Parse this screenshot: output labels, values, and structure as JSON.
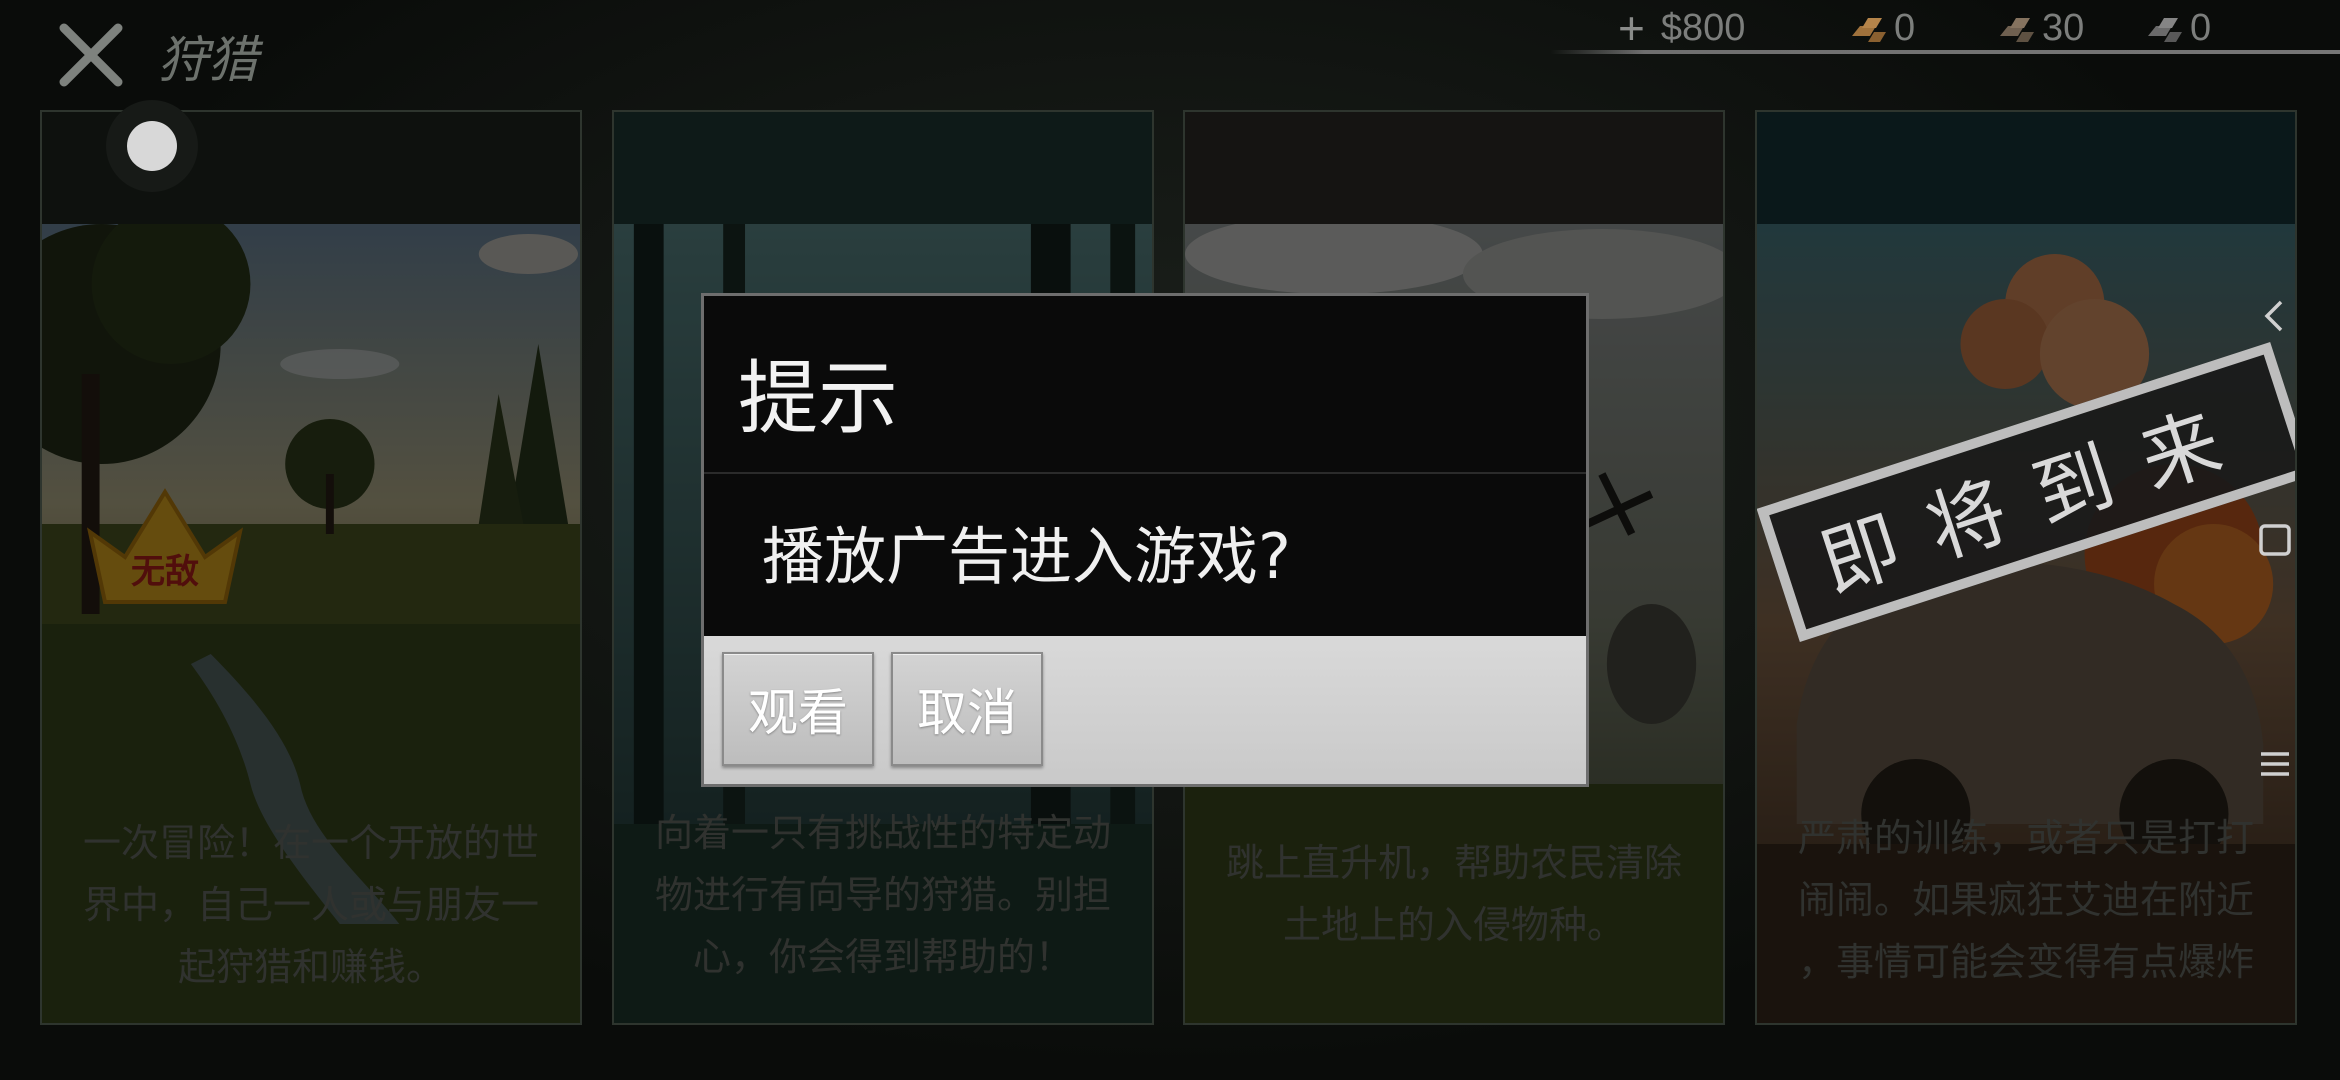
{
  "header": {
    "title": "狩猎",
    "close_icon": "close-icon"
  },
  "currencies": [
    {
      "icon": "plus-icon",
      "label": "$800"
    },
    {
      "icon": "gold-bars-icon",
      "label": "0"
    },
    {
      "icon": "bronze-bars-icon",
      "label": "30"
    },
    {
      "icon": "silver-bars-icon",
      "label": "0"
    }
  ],
  "cards": [
    {
      "header_color": "#1f271f",
      "badge": "无敌",
      "description_lines": [
        "一次冒险！在一个开放的世",
        "界中，自己一人或与朋友一",
        "起狩猎和赚钱。"
      ]
    },
    {
      "header_color": "#1f3a37",
      "description_lines": [
        "向着一只有挑战性的特定动",
        "物进行有向导的狩猎。别担",
        "心，你会得到帮助的！"
      ]
    },
    {
      "header_color": "#2f2e28",
      "description_lines": [
        "跳上直升机，帮助农民清除",
        "土地上的入侵物种。"
      ]
    },
    {
      "header_color": "#17353a",
      "stamp": "即将到来",
      "description_lines": [
        "严肃的训练，或者只是打打",
        "闹闹。如果疯狂艾迪在附近",
        "，事情可能会变得有点爆炸"
      ]
    }
  ],
  "side_nav": {
    "back_icon": "back-chevron-icon",
    "home_icon": "square-home-icon",
    "menu_icon": "menu-lines-icon"
  },
  "dialog": {
    "title": "提示",
    "message": "播放广告进入游戏?",
    "watch_label": "观看",
    "cancel_label": "取消"
  },
  "colors": {
    "card_text": "#6b6f69",
    "dialog_bg": "#0a0a0a",
    "dialog_footer": "#d0d0d0",
    "badge_gold": "#e0a81f",
    "stamp_white": "#d9d9d9"
  }
}
